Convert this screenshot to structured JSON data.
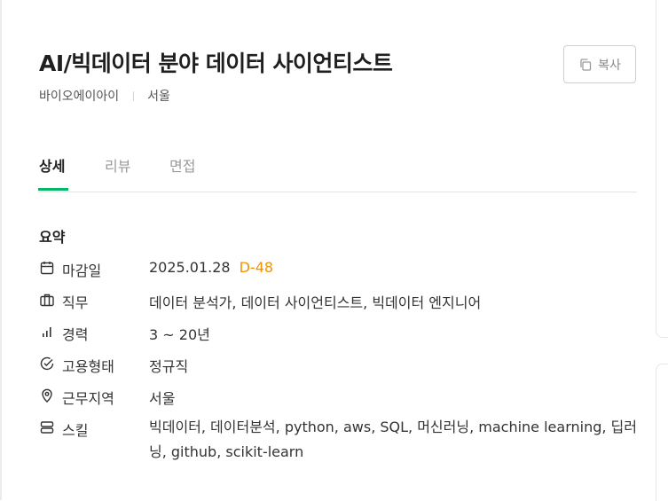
{
  "job": {
    "title": "AI/빅데이터 분야 데이터 사이언티스트",
    "company": "바이오에이아이",
    "location": "서울"
  },
  "actions": {
    "copy_label": "복사",
    "copy_icon": "copy-icon"
  },
  "tabs": [
    {
      "label": "상세",
      "active": true
    },
    {
      "label": "리뷰",
      "active": false
    },
    {
      "label": "면접",
      "active": false
    }
  ],
  "summary": {
    "title": "요약",
    "deadline": {
      "label": "마감일",
      "icon": "calendar-icon",
      "value": "2025.01.28",
      "dday": "D-48"
    },
    "duty": {
      "label": "직무",
      "icon": "briefcase-icon",
      "value": "데이터 분석가, 데이터 사이언티스트, 빅데이터 엔지니어"
    },
    "career": {
      "label": "경력",
      "icon": "bar-chart-icon",
      "value": "3 ~ 20년"
    },
    "employment": {
      "label": "고용형태",
      "icon": "check-circle-icon",
      "value": "정규직"
    },
    "region": {
      "label": "근무지역",
      "icon": "location-pin-icon",
      "value": "서울"
    },
    "skills": {
      "label": "스킬",
      "icon": "server-icon",
      "value": "빅데이터, 데이터분석, python, aws, SQL, 머신러닝, machine learning, 딥러닝, github, scikit-learn"
    }
  },
  "colors": {
    "accent": "#00b865",
    "dday": "#f39200"
  }
}
